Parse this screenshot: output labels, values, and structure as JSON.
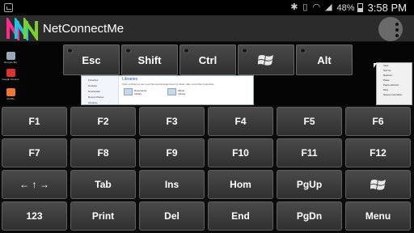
{
  "status_bar": {
    "battery_text": "48%",
    "battery_level": 0.48,
    "time": "3:58 PM",
    "icons": [
      "notification-icon",
      "bluetooth-icon",
      "vibrate-icon",
      "wifi-icon",
      "signal-icon",
      "battery-icon"
    ]
  },
  "app": {
    "title": "NetConnectMe",
    "logo_colors": [
      "#ff2a8a",
      "#19c6e6",
      "#7ad12b"
    ],
    "overflow_icon": "overflow-menu-icon"
  },
  "remote_desktop": {
    "desktop_icons": [
      {
        "label": "Recycle Bin",
        "color": "#9ab"
      },
      {
        "label": "Google Chrome",
        "color": "#d33"
      },
      {
        "label": "Mozilla",
        "color": "#e73"
      }
    ],
    "explorer": {
      "nav_items": [
        "Favorites",
        "Desktop",
        "Downloads",
        "Recent Places",
        "Libraries"
      ],
      "header": "Libraries",
      "subtitle": "Open a library to see your files and arrange them by folder, date, and other properties.",
      "libraries": [
        {
          "name": "Documents",
          "kind": "Library"
        },
        {
          "name": "Music",
          "kind": "Library"
        }
      ]
    },
    "context_menu": [
      "View",
      "Sort by",
      "Refresh",
      "Paste",
      "Paste shortcut",
      "New",
      "Screen resolution"
    ]
  },
  "modifier_keys": [
    {
      "label": "Esc",
      "icon": ""
    },
    {
      "label": "Shift",
      "icon": ""
    },
    {
      "label": "Ctrl",
      "icon": ""
    },
    {
      "label": "",
      "icon": "windows-logo-icon"
    },
    {
      "label": "Alt",
      "icon": ""
    }
  ],
  "keyboard": {
    "rows": [
      [
        "F1",
        "F2",
        "F3",
        "F4",
        "F5",
        "F6"
      ],
      [
        "F7",
        "F8",
        "F9",
        "F10",
        "F11",
        "F12"
      ],
      [
        "← ↑ →",
        "Tab",
        "Ins",
        "Hom",
        "PgUp",
        ""
      ],
      [
        "123",
        "Print",
        "Del",
        "End",
        "PgDn",
        "Menu"
      ]
    ],
    "windows_key_icon": "windows-logo-icon"
  }
}
